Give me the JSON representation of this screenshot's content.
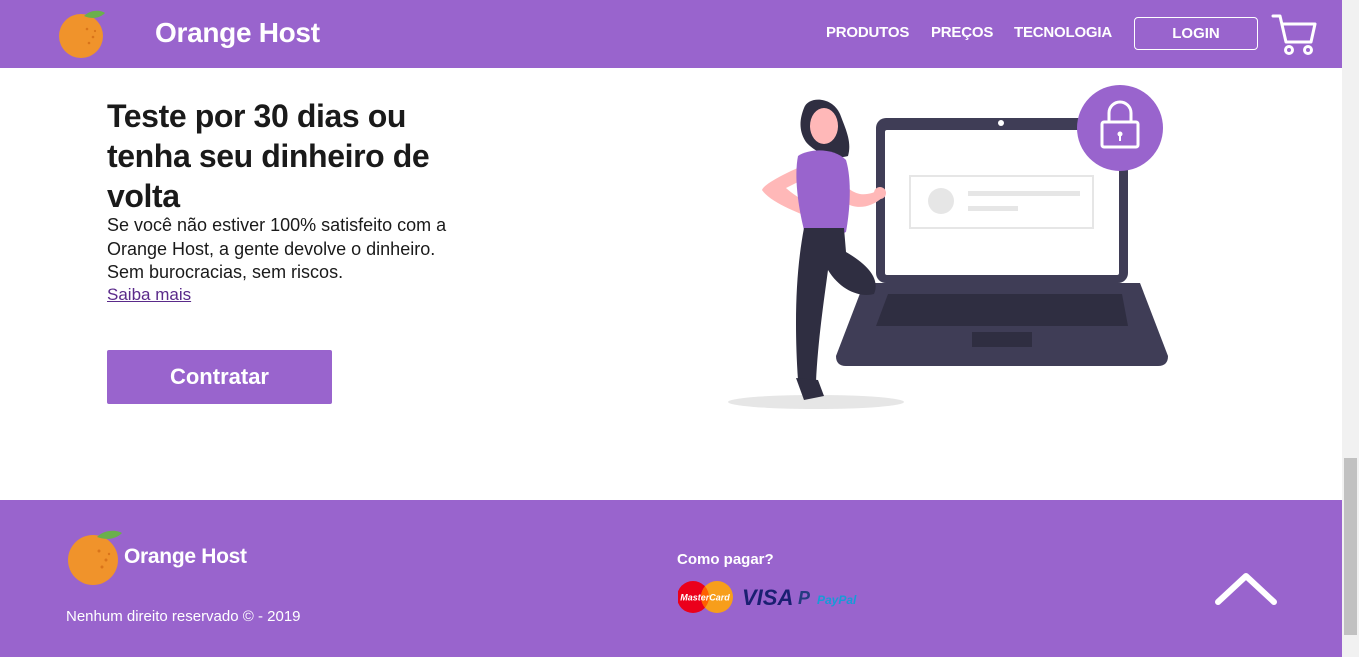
{
  "header": {
    "brand": "Orange Host",
    "nav": [
      "PRODUTOS",
      "PREÇOS",
      "TECNOLOGIA"
    ],
    "login_label": "LOGIN",
    "cart_icon": "shopping-cart-icon"
  },
  "hero": {
    "title": "Teste por 30 dias ou tenha seu dinheiro de volta",
    "text": "Se você não estiver 100% satisfeito com a Orange Host, a gente devolve o dinheiro. Sem burocracias, sem riscos.",
    "link_label": "Saiba mais",
    "cta_label": "Contratar"
  },
  "footer": {
    "brand": "Orange Host",
    "copyright": "Nenhum direito reservado © - 2019",
    "pay_title": "Como pagar?",
    "payment_logos": [
      "MasterCard",
      "VISA",
      "PayPal"
    ]
  },
  "colors": {
    "primary": "#9964cd",
    "orange": "#f0932b",
    "leaf": "#6ab04c",
    "laptop": "#3f3d56"
  }
}
